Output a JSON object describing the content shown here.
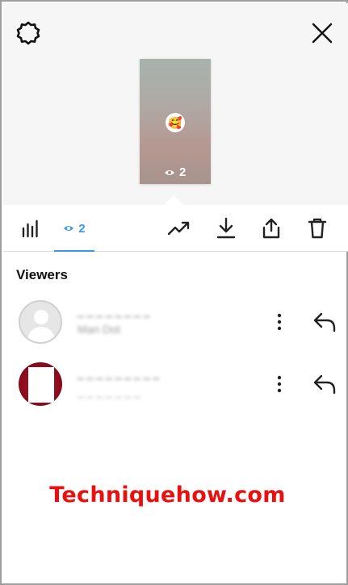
{
  "header": {
    "settings_icon": "gear-icon",
    "close_icon": "close-icon"
  },
  "story_preview": {
    "sticker": "🥰",
    "view_count": "2"
  },
  "toolbar": {
    "insights_icon": "bar-chart-icon",
    "viewers_tab_count": "2",
    "accent_color": "#3897f0",
    "actions": [
      "trending-icon",
      "download-icon",
      "share-icon",
      "trash-icon"
    ]
  },
  "viewers": {
    "title": "Viewers",
    "items": [
      {
        "username": "_ _ _ _ _ _ _ _",
        "full_name": "Man Dot"
      },
      {
        "username": "_ _ _ _ _ _ _ _ _",
        "full_name": "_ _ _ _ _ _ _"
      }
    ]
  },
  "watermark": {
    "text": "Techniquehow.com",
    "color": "#e81010"
  }
}
